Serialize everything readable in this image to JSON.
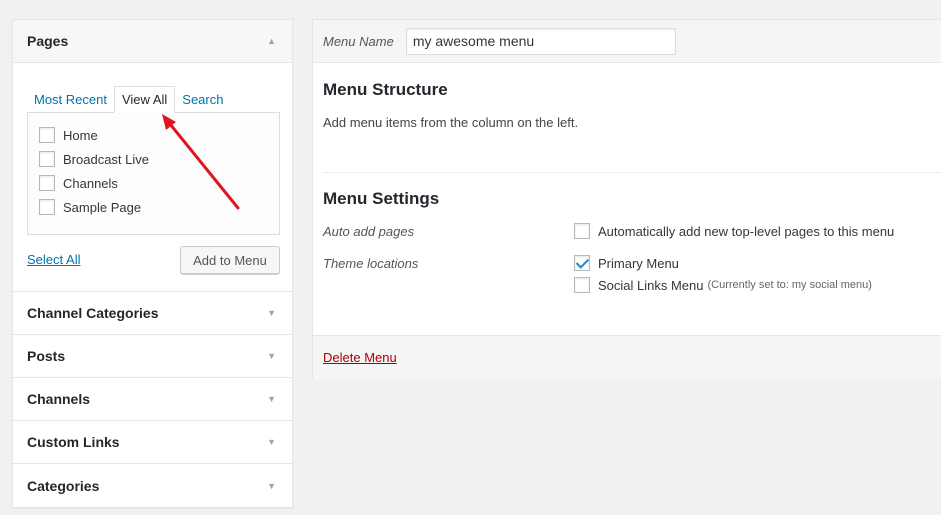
{
  "pages_box": {
    "title": "Pages",
    "tabs": [
      {
        "label": "Most Recent"
      },
      {
        "label": "View All"
      },
      {
        "label": "Search"
      }
    ],
    "items": [
      {
        "label": "Home"
      },
      {
        "label": "Broadcast Live"
      },
      {
        "label": "Channels"
      },
      {
        "label": "Sample Page"
      }
    ],
    "select_all": "Select All",
    "add_button": "Add to Menu"
  },
  "other_boxes": [
    {
      "title": "Channel Categories"
    },
    {
      "title": "Posts"
    },
    {
      "title": "Channels"
    },
    {
      "title": "Custom Links"
    },
    {
      "title": "Categories"
    }
  ],
  "menu": {
    "name_label": "Menu Name",
    "name_value": "my awesome menu",
    "structure_title": "Menu Structure",
    "structure_desc": "Add menu items from the column on the left.",
    "settings_title": "Menu Settings",
    "auto_add_label": "Auto add pages",
    "auto_add_text": "Automatically add new top-level pages to this menu",
    "theme_locations_label": "Theme locations",
    "locations": [
      {
        "label": "Primary Menu",
        "checked": true,
        "note": ""
      },
      {
        "label": "Social Links Menu",
        "checked": false,
        "note": "(Currently set to: my social menu)"
      }
    ],
    "delete_label": "Delete Menu"
  },
  "colors": {
    "link": "#0073aa",
    "delete": "#a00000",
    "annotation_arrow": "#e0141e"
  }
}
